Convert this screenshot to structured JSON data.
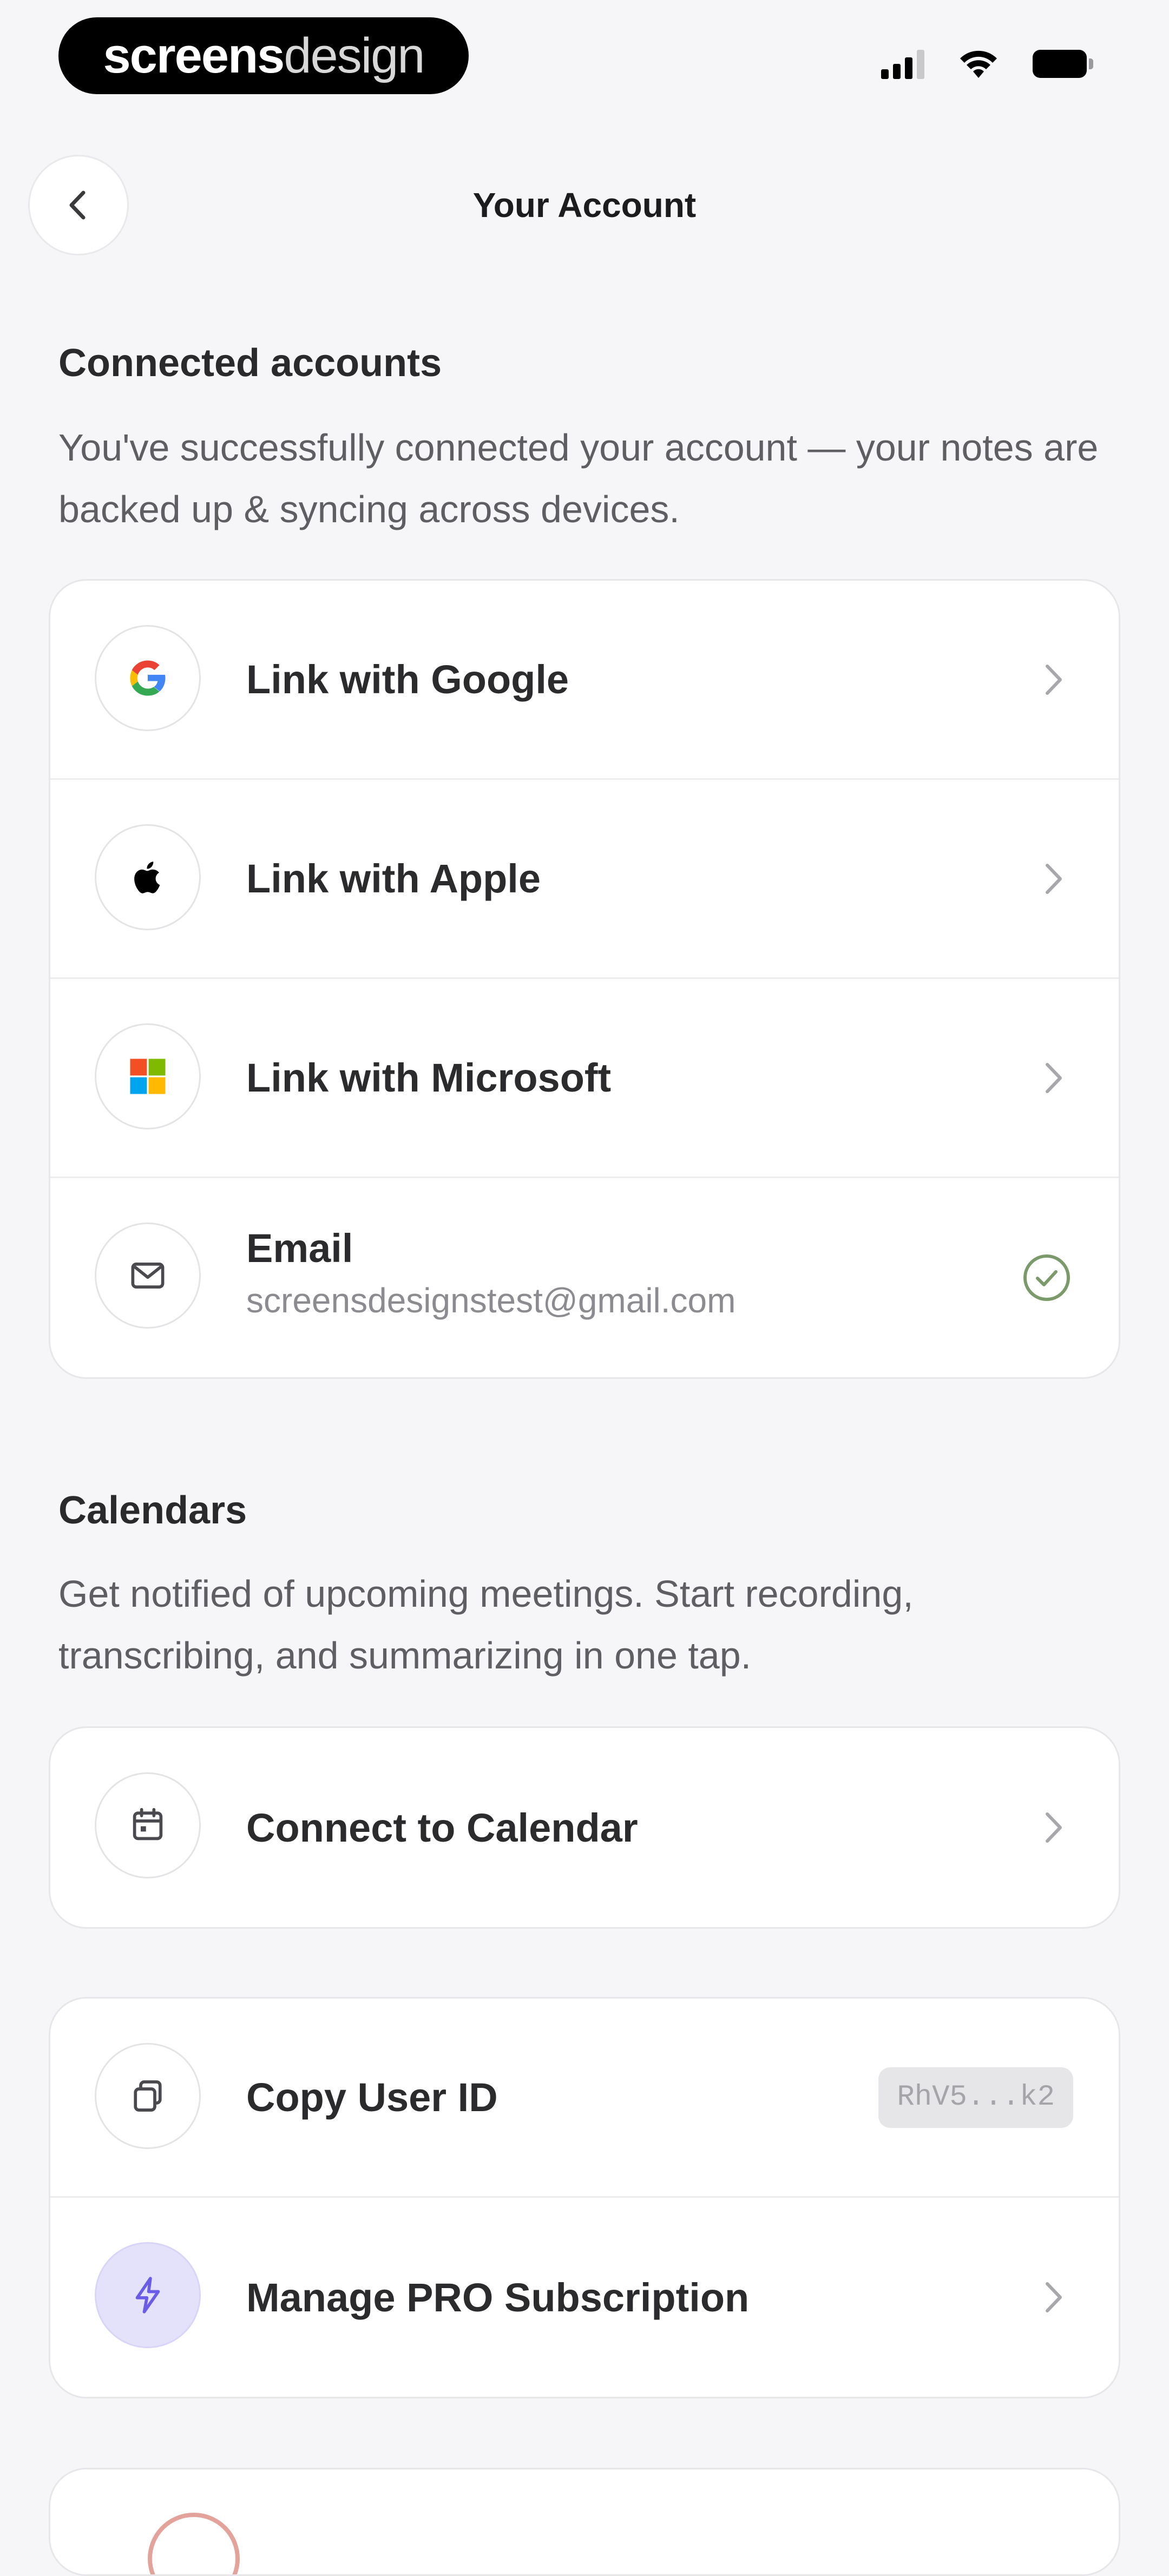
{
  "status_bar": {
    "brand_bold": "screens",
    "brand_thin": "design",
    "icons": [
      "signal-icon",
      "wifi-icon",
      "battery-icon"
    ]
  },
  "header": {
    "back_icon": "chevron-left-icon",
    "title": "Your Account"
  },
  "connected": {
    "heading": "Connected accounts",
    "description": "You've successfully connected your account — your notes are backed up & syncing across devices.",
    "rows": [
      {
        "label": "Link with Google",
        "icon": "google-icon"
      },
      {
        "label": "Link with Apple",
        "icon": "apple-icon"
      },
      {
        "label": "Link with Microsoft",
        "icon": "microsoft-icon"
      },
      {
        "label": "Email",
        "sub": "screensdesignstest@gmail.com",
        "icon": "mail-icon",
        "status_icon": "check-circle-icon"
      }
    ]
  },
  "calendars": {
    "heading": "Calendars",
    "description": "Get notified of upcoming meetings. Start recording, transcribing, and summarizing in one tap.",
    "connect_label": "Connect to Calendar",
    "connect_icon": "calendar-icon"
  },
  "account_tools": {
    "copy_id_label": "Copy User ID",
    "copy_id_icon": "copy-icon",
    "user_id_chip": "RhV5...k2",
    "subscription_label": "Manage PRO Subscription",
    "subscription_icon": "lightning-icon"
  },
  "colors": {
    "background": "#f6f6f8",
    "card": "#ffffff",
    "accent_purple": "#6b5ce7",
    "success_green": "#7a9a6a"
  }
}
